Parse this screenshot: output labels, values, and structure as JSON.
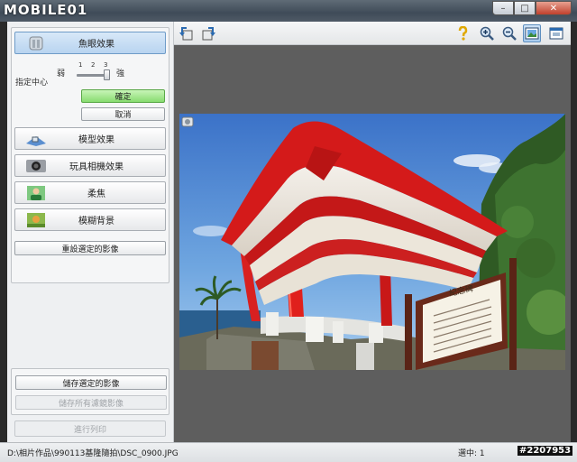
{
  "titlebar": {
    "logo": "MOBILE01",
    "minimize": "–",
    "maximize": "□",
    "close": "✕"
  },
  "effects": {
    "fisheye": "魚眼效果",
    "slider": {
      "weak": "弱",
      "strong": "強",
      "ticks": [
        "1",
        "2",
        "3"
      ],
      "value": 3
    },
    "center_label": "指定中心",
    "ok": "確定",
    "cancel": "取消",
    "model": "模型效果",
    "toy_camera": "玩具相機效果",
    "soft_focus": "柔焦",
    "blur_background": "模糊背景",
    "reset": "重設選定的影像"
  },
  "actions": {
    "save_selected": "儲存選定的影像",
    "save_all": "儲存所有濾鏡影像",
    "print": "進行列印"
  },
  "status": {
    "path": "D:\\相片作品\\990113基隆隨拍\\DSC_0900.JPG",
    "selection": "選中: 1",
    "watermark_id": "#2207953"
  },
  "photo": {
    "sign_title": "紀念碑"
  },
  "colors": {
    "accent": "#6f9cc8",
    "ok_green": "#88dc70",
    "viewer_bg": "#5e5e5e"
  }
}
